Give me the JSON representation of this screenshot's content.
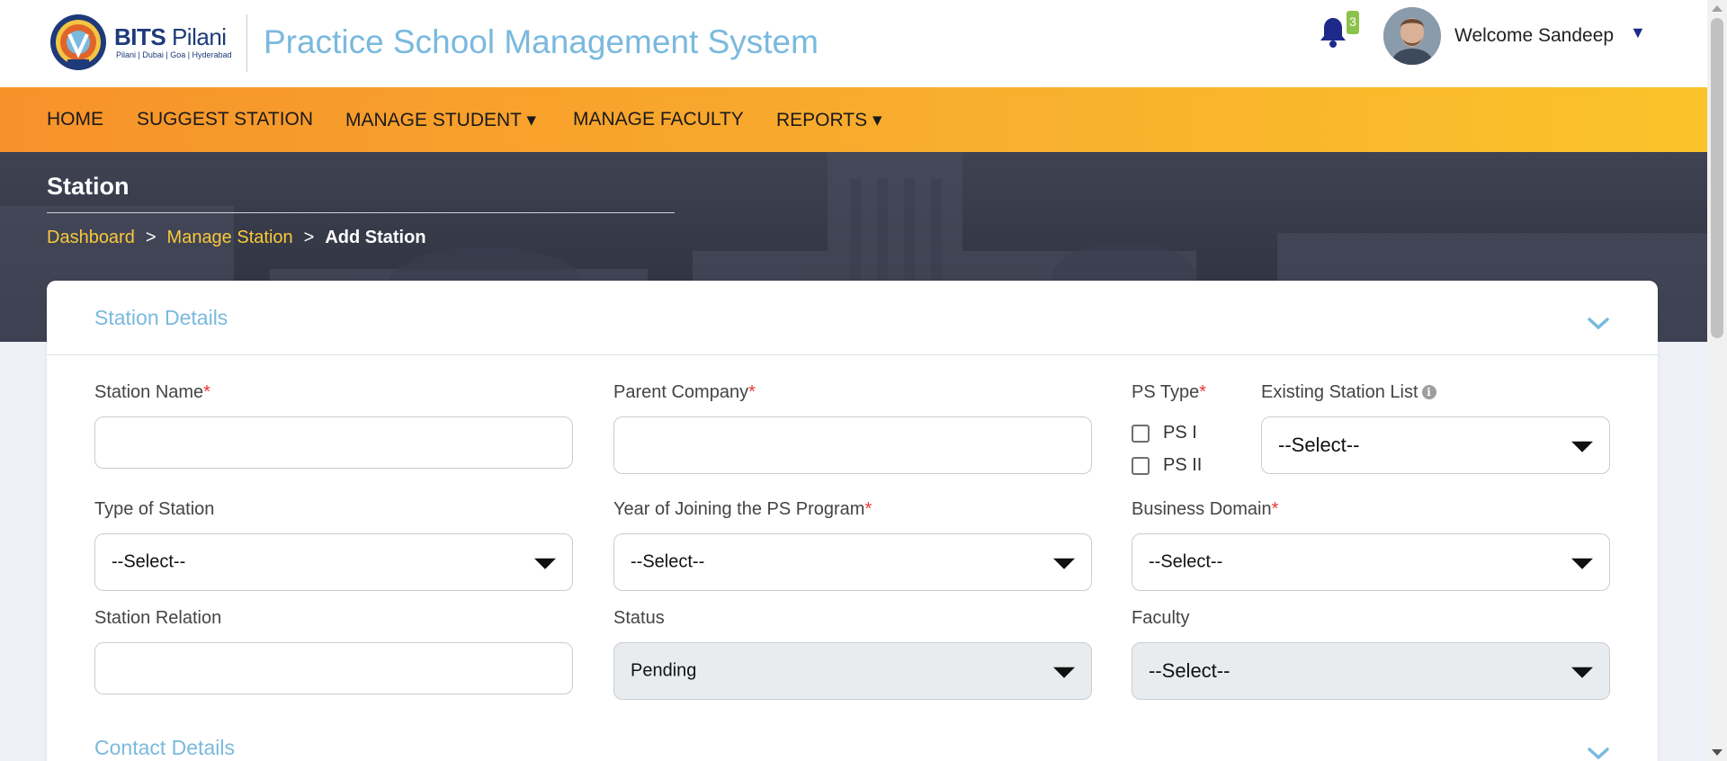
{
  "header": {
    "logo_name": "BITS",
    "logo_name_thin": "Pilani",
    "logo_campuses": "Pilani | Dubai | Goa | Hyderabad",
    "app_title": "Practice School Management System",
    "notification_count": "3",
    "welcome_text": "Welcome Sandeep",
    "caret": "▼"
  },
  "nav": {
    "items": [
      {
        "label": "HOME"
      },
      {
        "label": "SUGGEST STATION"
      },
      {
        "label": "MANAGE STUDENT ▾"
      },
      {
        "label": "MANAGE FACULTY"
      },
      {
        "label": "REPORTS ▾"
      }
    ]
  },
  "banner": {
    "heading": "Station",
    "breadcrumb": {
      "dashboard": "Dashboard",
      "manage_station": "Manage Station",
      "current": "Add Station",
      "separator": ">"
    }
  },
  "form": {
    "section_station_details": "Station Details",
    "section_contact_details": "Contact Details",
    "station_name_label": "Station Name",
    "parent_company_label": "Parent Company",
    "ps_type_label": "PS Type",
    "ps1_label": "PS I",
    "ps2_label": "PS II",
    "existing_station_label": "Existing Station List",
    "existing_station_value": "--Select--",
    "type_of_station_label": "Type of Station",
    "type_of_station_value": "--Select--",
    "year_joining_label": "Year of Joining the PS Program",
    "year_joining_value": "--Select--",
    "business_domain_label": "Business Domain",
    "business_domain_value": "--Select--",
    "station_relation_label": "Station Relation",
    "status_label": "Status",
    "status_value": "Pending",
    "faculty_label": "Faculty",
    "faculty_value": "--Select--",
    "required_mark": "*",
    "info_glyph": "i"
  },
  "colors": {
    "accent_blue": "#7ab9de",
    "nav_orange_start": "#f7922a",
    "nav_orange_end": "#fbc32a",
    "breadcrumb_link": "#f9c93a",
    "required_red": "#e53935",
    "badge_green": "#8bc34a",
    "bell_navy": "#1e2a8a"
  }
}
